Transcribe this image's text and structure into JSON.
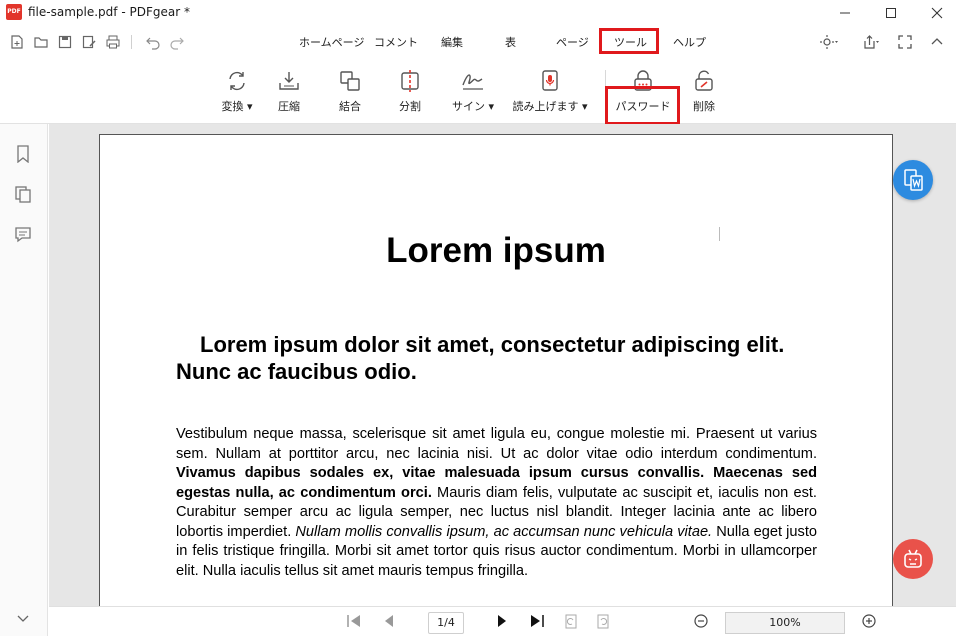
{
  "window": {
    "title": "file-sample.pdf - PDFgear *",
    "logo_text": "PDF"
  },
  "menu": {
    "items": [
      "ホームページ",
      "コメント",
      "編集",
      "表",
      "ページ",
      "ツール",
      "ヘルプ"
    ],
    "active": "ツール"
  },
  "ribbon": {
    "buttons": [
      {
        "label": "変換",
        "dropdown": "▾",
        "icon": "convert-icon"
      },
      {
        "label": "圧縮",
        "icon": "compress-icon"
      },
      {
        "label": "結合",
        "icon": "merge-icon"
      },
      {
        "label": "分割",
        "icon": "split-icon"
      },
      {
        "label": "サイン",
        "dropdown": "▾",
        "icon": "signature-icon"
      },
      {
        "label": "読み上げます",
        "dropdown": "▾",
        "icon": "read-aloud-icon"
      },
      {
        "label": "パスワード",
        "icon": "password-lock-icon"
      },
      {
        "label": "削除",
        "icon": "unlock-delete-icon"
      }
    ]
  },
  "document": {
    "title": "Lorem ipsum",
    "heading": "Lorem ipsum dolor sit amet, consectetur adipiscing elit. Nunc ac faucibus odio.",
    "para_1": "Vestibulum neque massa, scelerisque sit amet ligula eu, congue molestie mi. Praesent ut varius sem. Nullam at porttitor arcu, nec lacinia nisi. Ut ac dolor vitae odio interdum condimentum. ",
    "para_bold": "Vivamus dapibus sodales ex, vitae malesuada ipsum cursus convallis. Maecenas sed egestas nulla, ac condimentum orci.",
    "para_2": " Mauris diam felis, vulputate ac suscipit et, iaculis non est. Curabitur semper arcu ac ligula semper, nec luctus nisl blandit. Integer lacinia ante ac libero lobortis imperdiet. ",
    "para_italic": "Nullam mollis convallis ipsum, ac accumsan nunc vehicula vitae.",
    "para_3": " Nulla eget justo in felis tristique fringilla. Morbi sit amet tortor quis risus auctor condimentum. Morbi in ullamcorper elit. Nulla iaculis tellus sit amet mauris tempus fringilla."
  },
  "statusbar": {
    "page": "1/4",
    "zoom": "100%"
  },
  "colors": {
    "highlight": "#e0191c",
    "convert_fab": "#2d8be0",
    "robot_fab": "#e9524a"
  }
}
